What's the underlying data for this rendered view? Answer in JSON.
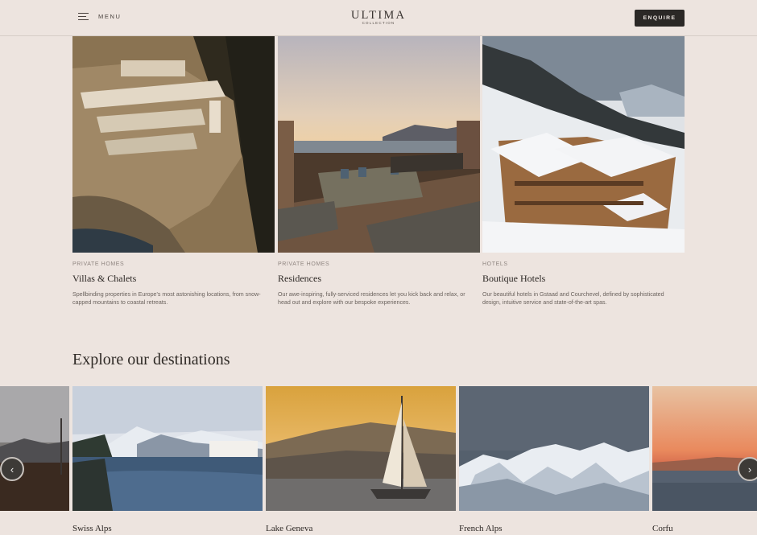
{
  "header": {
    "menu_label": "MENU",
    "logo_main": "ULTIMA",
    "logo_sub": "COLLECTION",
    "enquire_label": "ENQUIRE"
  },
  "cards": [
    {
      "category": "PRIVATE HOMES",
      "title": "Villas & Chalets",
      "description": "Spellbinding properties in Europe's most astonishing locations, from snow-capped mountains to coastal retreats."
    },
    {
      "category": "PRIVATE HOMES",
      "title": "Residences",
      "description": "Our awe-inspiring, fully-serviced residences let you kick back and relax, or head out and explore with our bespoke experiences."
    },
    {
      "category": "HOTELS",
      "title": "Boutique Hotels",
      "description": "Our beautiful hotels in Gstaad and Courchevel, defined by sophisticated design, intuitive service and state-of-the-art spas."
    }
  ],
  "destinations": {
    "heading": "Explore our destinations",
    "items": [
      {
        "name": "Swiss Alps"
      },
      {
        "name": "Lake Geneva"
      },
      {
        "name": "French Alps"
      },
      {
        "name": "Corfu"
      }
    ],
    "prev_icon": "chevron-left-icon",
    "next_icon": "chevron-right-icon"
  },
  "colors": {
    "background": "#ede4df",
    "button": "#2b2826"
  }
}
